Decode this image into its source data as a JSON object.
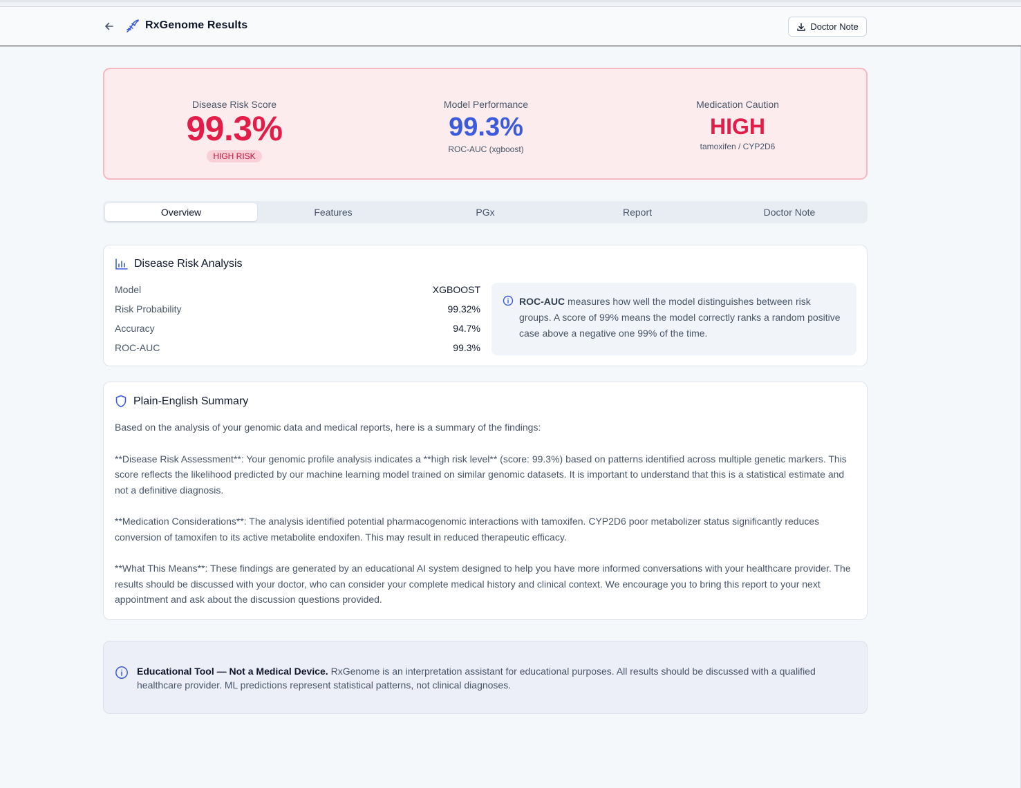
{
  "header": {
    "title": "RxGenome Results",
    "doctor_note_button": "Doctor Note"
  },
  "hero": {
    "risk": {
      "label": "Disease Risk Score",
      "value": "99.3%",
      "badge": "HIGH RISK"
    },
    "performance": {
      "label": "Model Performance",
      "value": "99.3%",
      "sub": "ROC-AUC (xgboost)"
    },
    "caution": {
      "label": "Medication Caution",
      "value": "HIGH",
      "sub": "tamoxifen / CYP2D6"
    }
  },
  "tabs": [
    "Overview",
    "Features",
    "PGx",
    "Report",
    "Doctor Note"
  ],
  "analysis": {
    "title": "Disease Risk Analysis",
    "metrics": [
      {
        "label": "Model",
        "value": "XGBOOST"
      },
      {
        "label": "Risk Probability",
        "value": "99.32%"
      },
      {
        "label": "Accuracy",
        "value": "94.7%"
      },
      {
        "label": "ROC-AUC",
        "value": "99.3%"
      }
    ],
    "info_bold": "ROC-AUC",
    "info_text": " measures how well the model distinguishes between risk groups. A score of 99% means the model correctly ranks a random positive case above a negative one 99% of the time."
  },
  "summary": {
    "title": "Plain-English Summary",
    "paragraphs": [
      "Based on the analysis of your genomic data and medical reports, here is a summary of the findings:",
      "**Disease Risk Assessment**: Your genomic profile analysis indicates a **high risk level** (score: 99.3%) based on patterns identified across multiple genetic markers. This score reflects the likelihood predicted by our machine learning model trained on similar genomic datasets. It is important to understand that this is a statistical estimate and not a definitive diagnosis.",
      "**Medication Considerations**: The analysis identified potential pharmacogenomic interactions with tamoxifen. CYP2D6 poor metabolizer status significantly reduces conversion of tamoxifen to its active metabolite endoxifen. This may result in reduced therapeutic efficacy.",
      "**What This Means**: These findings are generated by an educational AI system designed to help you have more informed conversations with your healthcare provider. The results should be discussed with your doctor, who can consider your complete medical history and clinical context. We encourage you to bring this report to your next appointment and ask about the discussion questions provided."
    ]
  },
  "disclaimer": {
    "bold": "Educational Tool — Not a Medical Device.",
    "text": " RxGenome is an interpretation assistant for educational purposes. All results should be discussed with a qualified healthcare provider. ML predictions represent statistical patterns, not clinical diagnoses."
  },
  "colors": {
    "accent_red": "#e11d48",
    "accent_blue": "#3b5bdb",
    "hero_bg": "#fdecee"
  }
}
